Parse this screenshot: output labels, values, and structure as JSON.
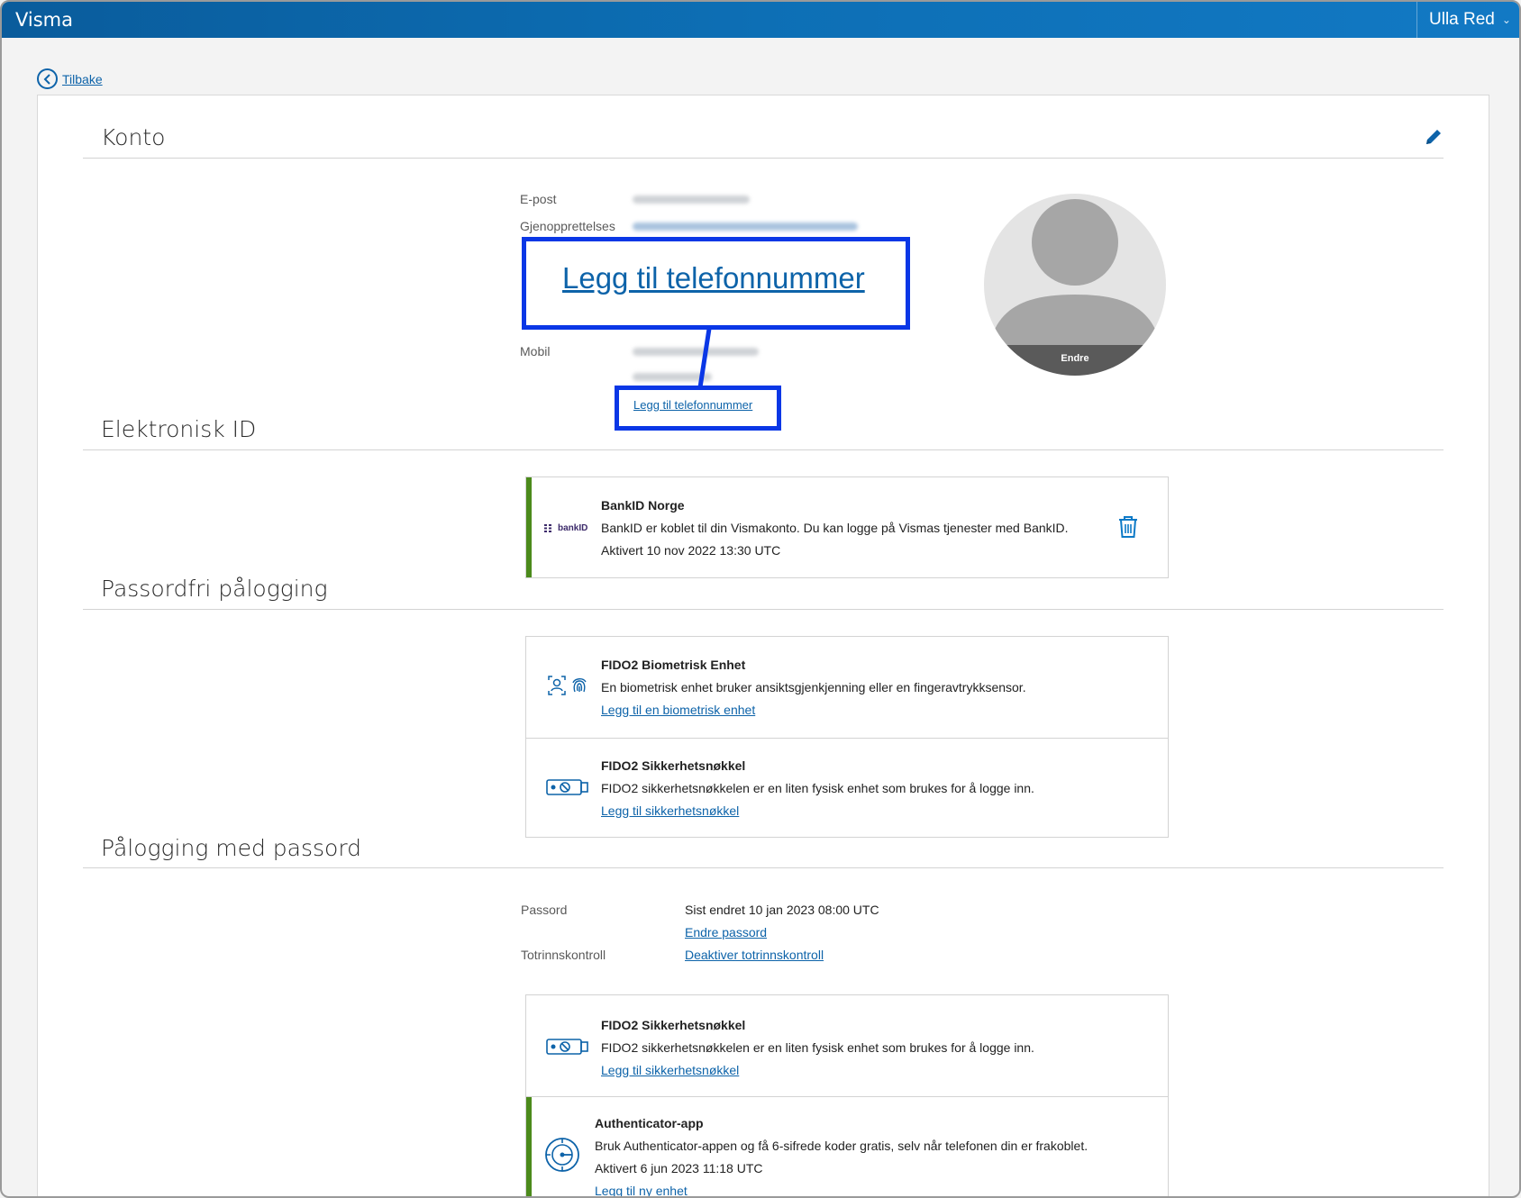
{
  "topbar": {
    "brand": "Visma",
    "user_name": "Ulla Red",
    "user_menu_icon": "chevron-down-icon"
  },
  "nav": {
    "back_label": "Tilbake"
  },
  "konto": {
    "title": "Konto",
    "edit_icon": "pencil-icon",
    "labels": {
      "email": "E-post",
      "recovery": "Gjenopprettelses",
      "mobile": "Mobil"
    },
    "add_phone_link": "Legg til telefonnummer",
    "zoom_callout_text": "Legg til telefonnummer",
    "avatar": {
      "change_label": "Endre"
    }
  },
  "elektronisk_id": {
    "title": "Elektronisk ID",
    "bankid": {
      "logo_text": "bankID",
      "title": "BankID Norge",
      "description": "BankID er koblet til din Vismakonto. Du kan logge på Vismas tjenester med BankID.",
      "activated": "Aktivert 10 nov 2022 13:30 UTC",
      "delete_icon": "trash-icon"
    }
  },
  "passordfri": {
    "title": "Passordfri pålogging",
    "items": [
      {
        "title": "FIDO2 Biometrisk Enhet",
        "description": "En biometrisk enhet bruker ansiktsgjenkjenning eller en fingeravtrykksensor.",
        "link": "Legg til en biometrisk enhet",
        "icon": "biometric-icon"
      },
      {
        "title": "FIDO2 Sikkerhetsnøkkel",
        "description": "FIDO2 sikkerhetsnøkkelen er en liten fysisk enhet som brukes for å logge inn.",
        "link": "Legg til sikkerhetsnøkkel",
        "icon": "security-key-icon"
      }
    ]
  },
  "passord": {
    "title": "Pålogging med passord",
    "password_label": "Passord",
    "password_value": "Sist endret 10 jan 2023 08:00 UTC",
    "change_password_link": "Endre passord",
    "twofactor_label": "Totrinnskontroll",
    "twofactor_link": "Deaktiver totrinnskontroll",
    "items": [
      {
        "title": "FIDO2 Sikkerhetsnøkkel",
        "description": "FIDO2 sikkerhetsnøkkelen er en liten fysisk enhet som brukes for å logge inn.",
        "link": "Legg til sikkerhetsnøkkel",
        "icon": "security-key-icon"
      },
      {
        "title": "Authenticator-app",
        "description": "Bruk Authenticator-appen og få 6-sifrede koder gratis, selv når telefonen din er frakoblet.",
        "activated": "Aktivert 6 jun 2023 11:18 UTC",
        "link": "Legg til ny enhet",
        "icon": "authenticator-icon"
      }
    ]
  },
  "colors": {
    "accent": "#0d63a9",
    "topbar": "#0d6fb5",
    "active_green": "#4b8a1b",
    "callout_blue": "#0a37e6"
  }
}
